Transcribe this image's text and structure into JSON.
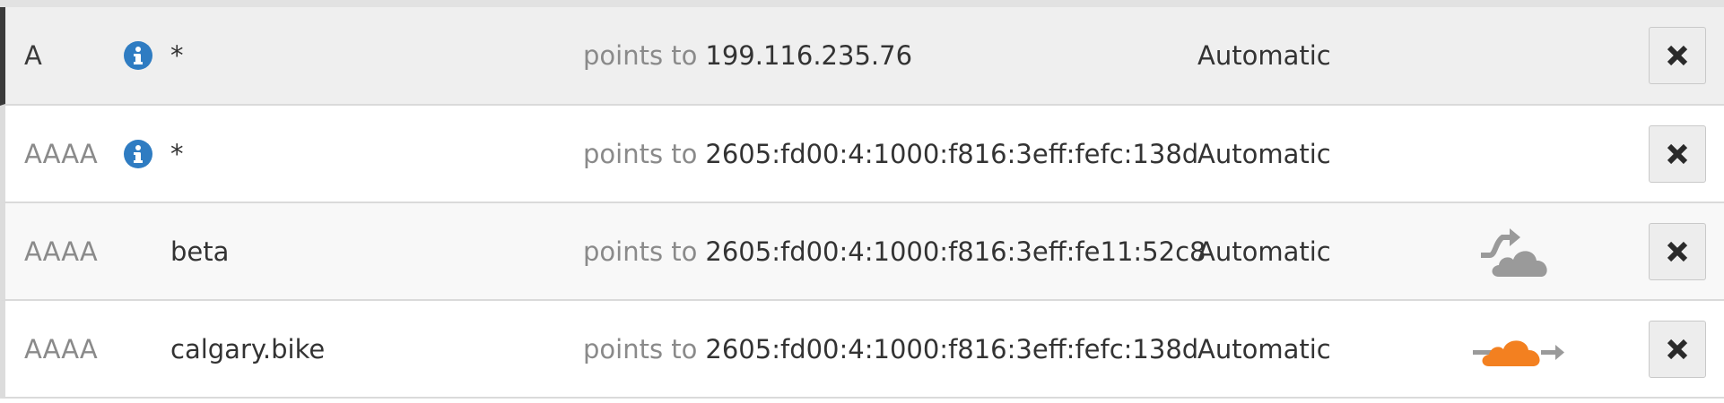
{
  "dns": {
    "points_to_label": "points to",
    "rows": [
      {
        "type": "A",
        "name": "*",
        "value": "199.116.235.76",
        "ttl": "Automatic",
        "info": true,
        "proxy": "none",
        "state": "hover"
      },
      {
        "type": "AAAA",
        "name": "*",
        "value": "2605:fd00:4:1000:f816:3eff:fefc:138d",
        "ttl": "Automatic",
        "info": true,
        "proxy": "none",
        "state": "normal"
      },
      {
        "type": "AAAA",
        "name": "beta",
        "value": "2605:fd00:4:1000:f816:3eff:fe11:52c8",
        "ttl": "Automatic",
        "info": false,
        "proxy": "dns-only",
        "state": "alt"
      },
      {
        "type": "AAAA",
        "name": "calgary.bike",
        "value": "2605:fd00:4:1000:f816:3eff:fefc:138d",
        "ttl": "Automatic",
        "info": false,
        "proxy": "proxied",
        "state": "normal"
      }
    ]
  },
  "colors": {
    "info_icon": "#2f7cc2",
    "proxied_cloud": "#f38020",
    "dns_only_cloud": "#9a9a9a"
  }
}
